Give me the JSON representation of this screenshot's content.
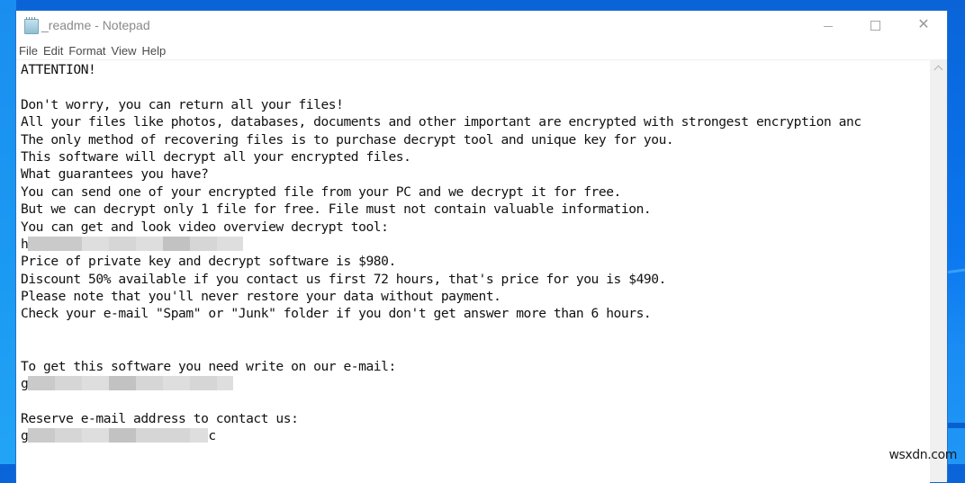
{
  "window": {
    "title": "_readme - Notepad",
    "app_icon": "notepad-icon",
    "controls": {
      "minimize": "minimize-icon",
      "maximize": "maximize-icon",
      "close": "close-icon",
      "close_glyph": "✕"
    }
  },
  "menubar": {
    "items": [
      "File",
      "Edit",
      "Format",
      "View",
      "Help"
    ]
  },
  "document": {
    "lines": [
      "ATTENTION!",
      "",
      "Don't worry, you can return all your files!",
      "All your files like photos, databases, documents and other important are encrypted with strongest encryption anc",
      "The only method of recovering files is to purchase decrypt tool and unique key for you.",
      "This software will decrypt all your encrypted files.",
      "What guarantees you have?",
      "You can send one of your encrypted file from your PC and we decrypt it for free.",
      "But we can decrypt only 1 file for free. File must not contain valuable information.",
      "You can get and look video overview decrypt tool:",
      "h",
      "Price of private key and decrypt software is $980.",
      "Discount 50% available if you contact us first 72 hours, that's price for you is $490.",
      "Please note that you'll never restore your data without payment.",
      "Check your e-mail \"Spam\" or \"Junk\" folder if you don't get answer more than 6 hours.",
      "",
      "",
      "To get this software you need write on our e-mail:",
      "g",
      "",
      "Reserve e-mail address to contact us:",
      "g",
      ""
    ],
    "redacted_line_suffixes": {
      "10": "",
      "18": "",
      "21": "c"
    }
  },
  "scrollbar": {
    "up_arrow": "chevron-up-icon"
  },
  "watermark": "wsxdn.com"
}
